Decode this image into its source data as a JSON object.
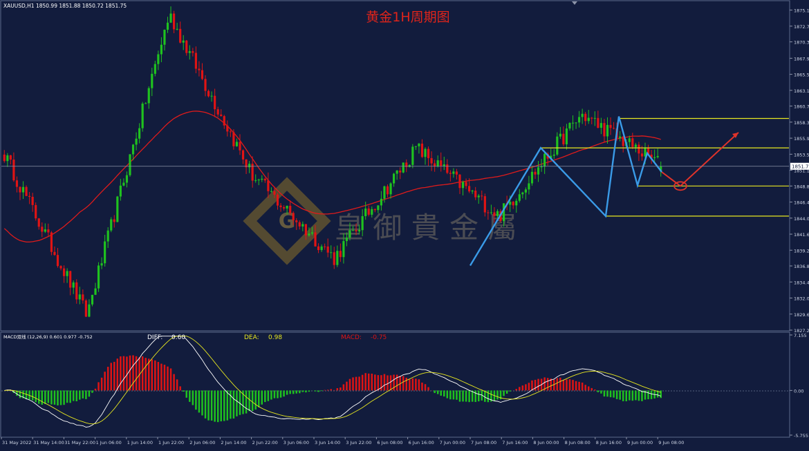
{
  "header": {
    "symbol_info": "XAUUSD,H1  1850.99 1851.88 1850.72 1851.75",
    "title": "黄金1H周期图"
  },
  "watermark": {
    "text": "皇 御 貴 金 屬",
    "logo_letter": "G"
  },
  "price_axis": {
    "ticks": [
      "1875.10",
      "1872.70",
      "1870.35",
      "1867.90",
      "1865.50",
      "1863.10",
      "1860.75",
      "1858.35",
      "1855.95",
      "1853.55",
      "1851.15",
      "1848.80",
      "1846.40",
      "1844.00",
      "1841.60",
      "1839.20",
      "1836.85",
      "1834.45",
      "1832.05",
      "1829.65",
      "1827.25"
    ],
    "current_price_label": "1851.75"
  },
  "macd_panel": {
    "label": "MACD双线 (12,26,9) 0.601 0.977 -0.752",
    "diff_label": "DIFF:",
    "diff_value": "0.60",
    "dea_label": "DEA:",
    "dea_value": "0.98",
    "macd_label": "MACD:",
    "macd_value": "-0.75",
    "ticks": [
      "7.155",
      "0.00",
      "-5.755"
    ]
  },
  "time_axis": {
    "labels": [
      "31 May 2022",
      "31 May 14:00",
      "31 May 22:00",
      "1 Jun 06:00",
      "1 Jun 14:00",
      "1 Jun 22:00",
      "2 Jun 06:00",
      "2 Jun 14:00",
      "2 Jun 22:00",
      "3 Jun 06:00",
      "3 Jun 14:00",
      "3 Jun 22:00",
      "6 Jun 08:00",
      "6 Jun 16:00",
      "7 Jun 00:00",
      "7 Jun 08:00",
      "7 Jun 16:00",
      "8 Jun 00:00",
      "8 Jun 08:00",
      "8 Jun 16:00",
      "9 Jun 00:00",
      "9 Jun 08:00"
    ]
  },
  "colors": {
    "background": "#121c3d",
    "bull": "#1fc21f",
    "bear": "#e01414",
    "ma_line": "#e01b1b",
    "level_line": "#e8e820",
    "wave_arrow": "#3a9be8",
    "forecast_arrow": "#e0332a",
    "axis_text": "#cfd6e6"
  },
  "chart_data": {
    "type": "candlestick",
    "symbol": "XAUUSD",
    "timeframe": "H1",
    "ylim": [
      1827.25,
      1876.3
    ],
    "ohlc_summary": {
      "open": 1850.99,
      "high": 1851.88,
      "low": 1850.72,
      "close": 1851.75
    },
    "key_points": [
      {
        "time": "31 May 2022",
        "price": 1853.5
      },
      {
        "time": "1 Jun 14:00",
        "price": 1829.5
      },
      {
        "time": "3 Jun 06:00",
        "price": 1874.5
      },
      {
        "time": "6 Jun 08:00",
        "price": 1850.5
      },
      {
        "time": "7 Jun 08:00",
        "price": 1838.0
      },
      {
        "time": "8 Jun 00:00",
        "price": 1854.5
      },
      {
        "time": "8 Jun 16:00",
        "price": 1844.3
      },
      {
        "time": "9 Jun 00:00",
        "price": 1859.5
      },
      {
        "time": "9 Jun 08:00",
        "price": 1851.75
      }
    ],
    "horizontal_levels": [
      1858.9,
      1854.5,
      1848.8,
      1844.3
    ],
    "macd": {
      "diff": 0.601,
      "dea": 0.977,
      "macd": -0.752,
      "ylim": [
        -5.755,
        7.155
      ]
    }
  }
}
